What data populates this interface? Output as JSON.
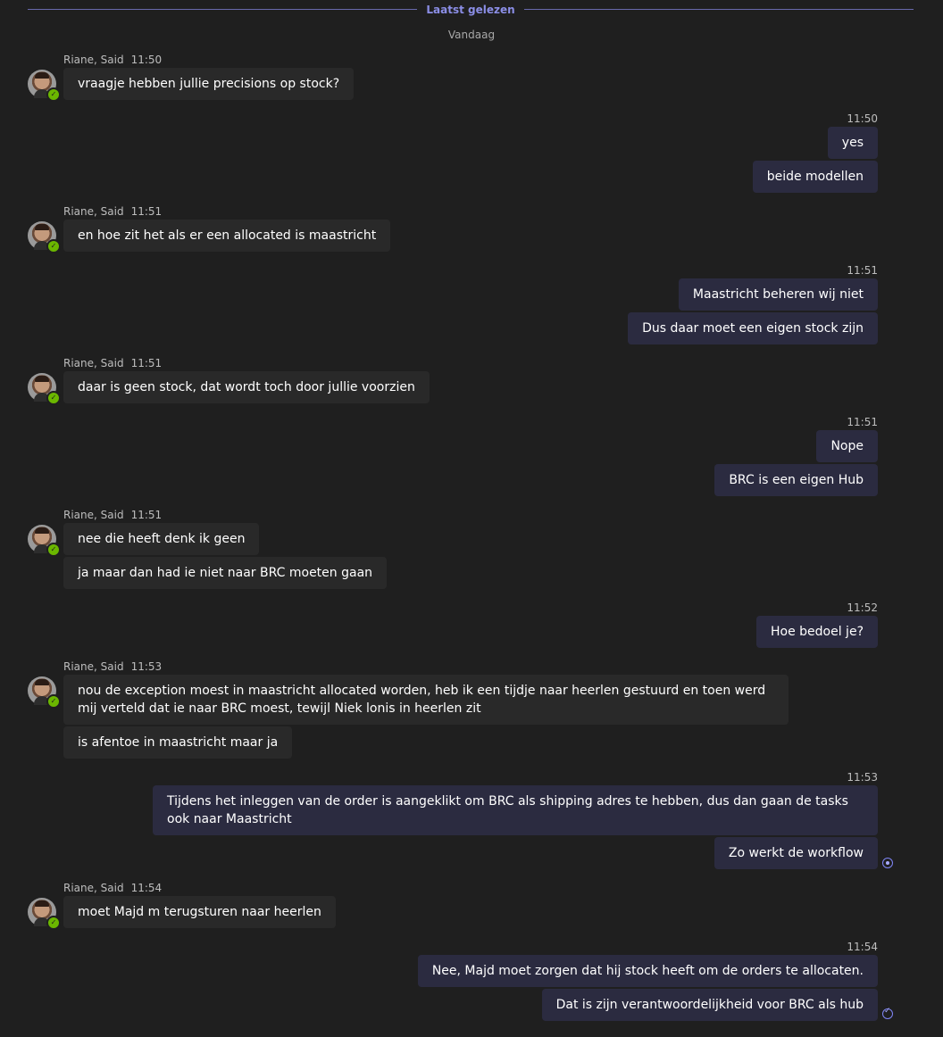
{
  "divider": {
    "label": "Laatst gelezen"
  },
  "date_separator": "Vandaag",
  "contact": {
    "name": "Riane, Said"
  },
  "messages": {
    "g1": {
      "time": "11:50",
      "texts": [
        "vraagje hebben jullie precisions op stock?"
      ]
    },
    "g2": {
      "time": "11:50",
      "texts": [
        "yes",
        "beide modellen"
      ]
    },
    "g3": {
      "time": "11:51",
      "texts": [
        "en hoe zit het als er een allocated is maastricht"
      ]
    },
    "g4": {
      "time": "11:51",
      "texts": [
        "Maastricht beheren wij niet",
        "Dus daar moet een eigen stock zijn"
      ]
    },
    "g5": {
      "time": "11:51",
      "texts": [
        "daar is geen stock, dat wordt toch door jullie voorzien"
      ]
    },
    "g6": {
      "time": "11:51",
      "texts": [
        "Nope",
        "BRC is een eigen Hub"
      ]
    },
    "g7": {
      "time": "11:51",
      "texts": [
        "nee die heeft denk ik geen",
        "ja maar dan had ie niet naar BRC moeten gaan"
      ]
    },
    "g8": {
      "time": "11:52",
      "texts": [
        "Hoe bedoel je?"
      ]
    },
    "g9": {
      "time": "11:53",
      "texts": [
        "nou de exception moest in maastricht allocated worden, heb ik een tijdje naar heerlen gestuurd en toen werd mij verteld dat ie naar BRC moest, tewijl Niek lonis in heerlen zit",
        "is afentoe in maastricht maar ja"
      ]
    },
    "g10": {
      "time": "11:53",
      "texts": [
        "Tijdens het inleggen van de order is aangeklikt om BRC als shipping adres te hebben, dus dan gaan de tasks ook naar Maastricht",
        "Zo werkt de workflow"
      ]
    },
    "g11": {
      "time": "11:54",
      "texts": [
        "moet Majd m terugsturen naar heerlen"
      ]
    },
    "g12": {
      "time": "11:54",
      "texts": [
        "Nee, Majd moet zorgen dat hij stock heeft om de orders te allocaten.",
        "Dat is zijn verantwoordelijkheid voor BRC als hub"
      ]
    }
  },
  "icons": {
    "presence": "available-check-icon",
    "seen": "seen-eye-icon",
    "read": "read-check-icon"
  },
  "colors": {
    "accent": "#7f85f5",
    "incoming_bubble": "#292929",
    "outgoing_bubble": "#2b2b40",
    "presence": "#6bb700"
  }
}
